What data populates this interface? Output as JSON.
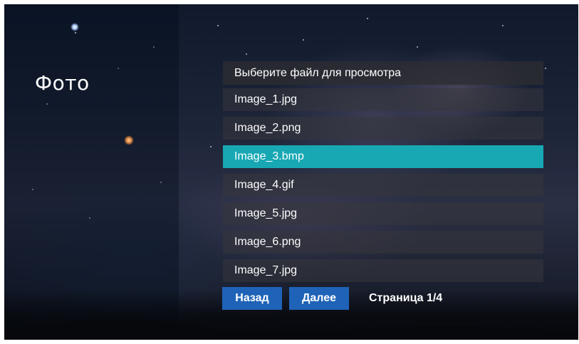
{
  "title": "Фото",
  "list": {
    "header": "Выберите файл для просмотра",
    "items": [
      {
        "label": "Image_1.jpg",
        "selected": false
      },
      {
        "label": "Image_2.png",
        "selected": false
      },
      {
        "label": "Image_3.bmp",
        "selected": true
      },
      {
        "label": "Image_4.gif",
        "selected": false
      },
      {
        "label": "Image_5.jpg",
        "selected": false
      },
      {
        "label": "Image_6.png",
        "selected": false
      },
      {
        "label": "Image_7.jpg",
        "selected": false
      }
    ]
  },
  "nav": {
    "back_label": "Назад",
    "next_label": "Далее",
    "page_text": "Страница 1/4"
  },
  "colors": {
    "selected": "#17a8b4",
    "button": "#1f63b8"
  }
}
